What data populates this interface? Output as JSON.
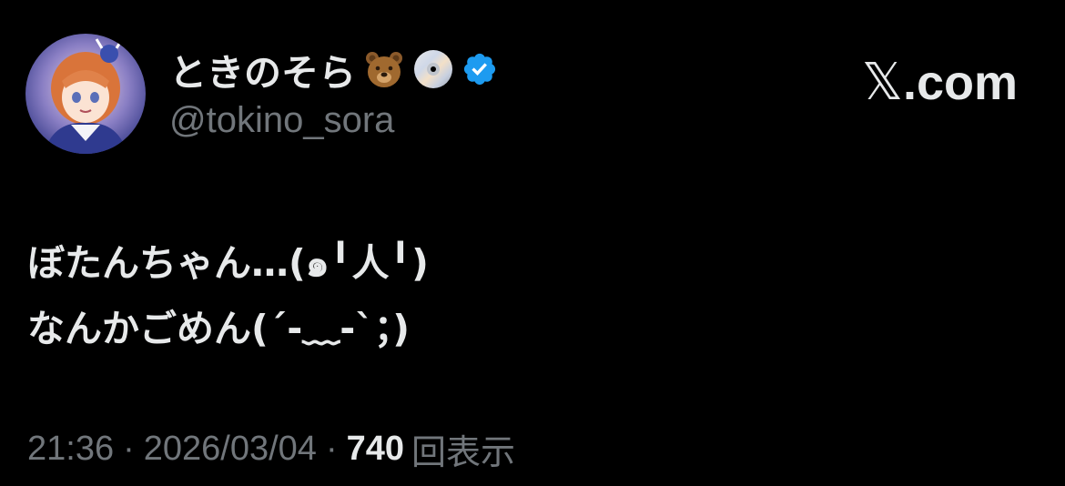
{
  "author": {
    "display_name": "ときのそら",
    "emojis": [
      "bear-face-emoji",
      "dvd-emoji"
    ],
    "verified": true,
    "handle": "@tokino_sora",
    "avatar": "avatar-image"
  },
  "brand": {
    "mark": "𝕏",
    "text": ".com"
  },
  "tweet": {
    "lines": [
      "ぼたんちゃん…(๑╹人╹)",
      "なんかごめん(´-﹏-`；)"
    ]
  },
  "meta": {
    "time": "21:36",
    "date": "2026/03/04",
    "separator": "·",
    "views_count": "740",
    "views_label": "回表示"
  },
  "colors": {
    "background": "#000000",
    "primary_text": "#e7e9ea",
    "secondary_text": "#71767b",
    "verified_badge": "#1d9bf0"
  }
}
